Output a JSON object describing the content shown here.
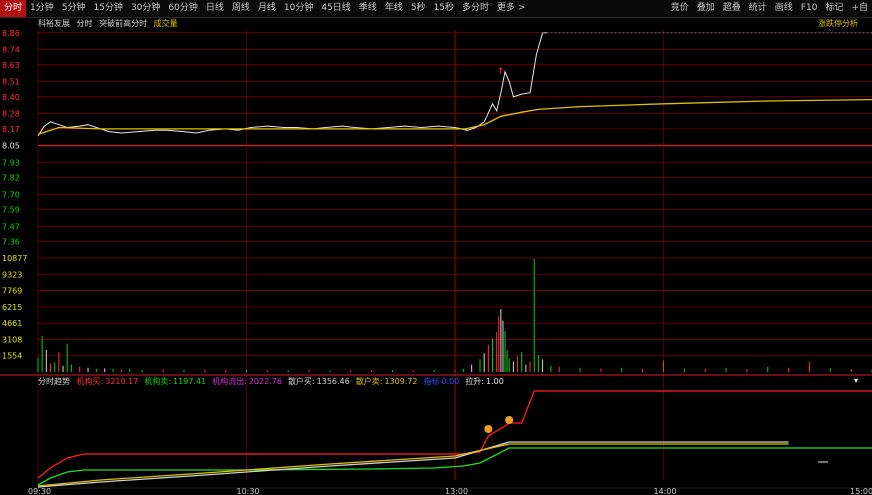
{
  "toolbar": {
    "periods": [
      "分时",
      "1分钟",
      "5分钟",
      "15分钟",
      "30分钟",
      "60分钟",
      "日线",
      "周线",
      "月线",
      "10分钟",
      "45日线",
      "季线",
      "年线",
      "5秒",
      "15秒",
      "多分时",
      "更多 >"
    ],
    "active_period": "分时",
    "tools": [
      "竞价",
      "叠加",
      "超叠",
      "统计",
      "画线",
      "F10",
      "标记",
      "+自"
    ]
  },
  "stock": {
    "name": "科裕友展",
    "chart_mode": "分时",
    "overlay": "突破前高分时",
    "volume_label": "成交量",
    "analysis_link": "涨跌停分析"
  },
  "colors": {
    "up": "#ff3232",
    "down": "#00d000",
    "price_line": "#e8e8e8",
    "avg_line": "#e0c000",
    "grid": "#7a0000",
    "accent": "#e0c000"
  },
  "price_axis": {
    "labels": [
      "8.86",
      "8.74",
      "8.63",
      "8.51",
      "8.40",
      "8.28",
      "8.17",
      "8.05",
      "7.93",
      "7.82",
      "7.70",
      "7.59",
      "7.47",
      "7.36"
    ],
    "prev_close": "8.05"
  },
  "volume_axis": {
    "labels": [
      "10877",
      "9323",
      "7769",
      "6215",
      "4661",
      "3108",
      "1554"
    ]
  },
  "time_axis": {
    "labels": [
      "09:30",
      "10:30",
      "13:00",
      "14:00",
      "15:00"
    ]
  },
  "indicator": {
    "name": "分时趋势",
    "items": [
      {
        "label": "机构买:",
        "value": "3210.17",
        "color": "#ff3030"
      },
      {
        "label": "机构卖:",
        "value": "1197.41",
        "color": "#00d000"
      },
      {
        "label": "机构流出:",
        "value": "2022.76",
        "color": "#d030d0"
      },
      {
        "label": "散户买:",
        "value": "1356.46",
        "color": "#d0d0d0"
      },
      {
        "label": "散户卖:",
        "value": "1309.72",
        "color": "#e0c000"
      },
      {
        "label": "指标",
        "value": "0.00",
        "color": "#3050ff"
      },
      {
        "label": "拉升:",
        "value": "1.00",
        "color": "#e8e8e8"
      }
    ]
  },
  "chart_data": {
    "type": "line",
    "x_axis": "time",
    "x_ticks": [
      "09:30",
      "10:30",
      "13:00",
      "14:00",
      "15:00"
    ],
    "price": {
      "ylim": [
        7.3,
        8.88
      ],
      "prev_close": 8.05,
      "series": [
        {
          "values": [
            [
              0,
              8.12
            ],
            [
              3,
              8.19
            ],
            [
              6,
              8.22
            ],
            [
              10,
              8.2
            ],
            [
              14,
              8.18
            ],
            [
              20,
              8.19
            ],
            [
              24,
              8.2
            ],
            [
              28,
              8.18
            ],
            [
              34,
              8.15
            ],
            [
              40,
              8.14
            ],
            [
              48,
              8.15
            ],
            [
              56,
              8.16
            ],
            [
              62,
              8.16
            ],
            [
              70,
              8.15
            ],
            [
              76,
              8.14
            ],
            [
              82,
              8.16
            ],
            [
              90,
              8.17
            ],
            [
              96,
              8.16
            ],
            [
              102,
              8.18
            ],
            [
              110,
              8.19
            ],
            [
              118,
              8.18
            ],
            [
              124,
              8.18
            ],
            [
              132,
              8.17
            ],
            [
              138,
              8.18
            ],
            [
              146,
              8.19
            ],
            [
              152,
              8.18
            ],
            [
              160,
              8.17
            ],
            [
              168,
              8.18
            ],
            [
              176,
              8.19
            ],
            [
              184,
              8.18
            ],
            [
              192,
              8.19
            ],
            [
              200,
              8.18
            ],
            [
              206,
              8.16
            ],
            [
              210,
              8.18
            ],
            [
              214,
              8.22
            ],
            [
              218,
              8.35
            ],
            [
              220,
              8.3
            ],
            [
              222,
              8.43
            ],
            [
              224,
              8.58
            ],
            [
              226,
              8.51
            ],
            [
              228,
              8.4
            ],
            [
              232,
              8.42
            ],
            [
              236,
              8.43
            ],
            [
              239,
              8.7
            ],
            [
              242,
              8.86
            ],
            [
              244,
              8.86
            ]
          ]
        },
        {
          "values": [
            [
              0,
              8.13
            ],
            [
              10,
              8.18
            ],
            [
              30,
              8.17
            ],
            [
              60,
              8.17
            ],
            [
              100,
              8.17
            ],
            [
              140,
              8.17
            ],
            [
              180,
              8.17
            ],
            [
              205,
              8.17
            ],
            [
              214,
              8.2
            ],
            [
              222,
              8.26
            ],
            [
              232,
              8.29
            ],
            [
              240,
              8.31
            ],
            [
              260,
              8.33
            ],
            [
              300,
              8.35
            ],
            [
              350,
              8.37
            ],
            [
              400,
              8.38
            ]
          ]
        }
      ]
    },
    "volume": {
      "ylim": [
        0,
        10877
      ],
      "values": [
        [
          0,
          1400
        ],
        [
          2,
          3400
        ],
        [
          4,
          2100
        ],
        [
          6,
          800
        ],
        [
          8,
          900
        ],
        [
          10,
          1900
        ],
        [
          12,
          600
        ],
        [
          14,
          2700
        ],
        [
          16,
          700
        ],
        [
          20,
          500
        ],
        [
          24,
          400
        ],
        [
          28,
          300
        ],
        [
          32,
          350
        ],
        [
          36,
          300
        ],
        [
          40,
          250
        ],
        [
          44,
          300
        ],
        [
          50,
          200
        ],
        [
          60,
          250
        ],
        [
          70,
          200
        ],
        [
          80,
          220
        ],
        [
          90,
          180
        ],
        [
          100,
          200
        ],
        [
          110,
          160
        ],
        [
          120,
          180
        ],
        [
          130,
          200
        ],
        [
          140,
          150
        ],
        [
          150,
          180
        ],
        [
          160,
          170
        ],
        [
          170,
          200
        ],
        [
          180,
          160
        ],
        [
          190,
          200
        ],
        [
          200,
          220
        ],
        [
          204,
          300
        ],
        [
          208,
          700
        ],
        [
          212,
          1200
        ],
        [
          214,
          1800
        ],
        [
          216,
          2600
        ],
        [
          218,
          3200
        ],
        [
          220,
          3800
        ],
        [
          221,
          5300
        ],
        [
          222,
          6000
        ],
        [
          223,
          4900
        ],
        [
          224,
          3900
        ],
        [
          225,
          2100
        ],
        [
          226,
          1300
        ],
        [
          228,
          1000
        ],
        [
          230,
          1500
        ],
        [
          232,
          1900
        ],
        [
          234,
          700
        ],
        [
          236,
          1000
        ],
        [
          238,
          10800
        ],
        [
          240,
          1600
        ],
        [
          242,
          1200
        ],
        [
          246,
          600
        ],
        [
          250,
          500
        ],
        [
          260,
          400
        ],
        [
          270,
          350
        ],
        [
          280,
          400
        ],
        [
          290,
          300
        ],
        [
          300,
          1100
        ],
        [
          310,
          350
        ],
        [
          320,
          300
        ],
        [
          330,
          400
        ],
        [
          340,
          300
        ],
        [
          350,
          500
        ],
        [
          360,
          400
        ],
        [
          370,
          1000
        ],
        [
          380,
          350
        ],
        [
          390,
          300
        ],
        [
          400,
          200
        ]
      ]
    },
    "trend": {
      "series": [
        {
          "name": "机构买",
          "values": [
            [
              0,
              1
            ],
            [
              6,
              2
            ],
            [
              14,
              3
            ],
            [
              22,
              3.4
            ],
            [
              100,
              3.4
            ],
            [
              204,
              3.4
            ],
            [
              212,
              3.6
            ],
            [
              216,
              5.2
            ],
            [
              224,
              6.2
            ],
            [
              226,
              6.5
            ],
            [
              232,
              6.5
            ],
            [
              238,
              9.7
            ],
            [
              400,
              9.7
            ]
          ]
        },
        {
          "name": "机构卖",
          "values": [
            [
              0,
              0.3
            ],
            [
              6,
              1
            ],
            [
              14,
              1.6
            ],
            [
              22,
              1.8
            ],
            [
              100,
              1.8
            ],
            [
              160,
              1.9
            ],
            [
              190,
              2.0
            ],
            [
              204,
              2.2
            ],
            [
              212,
              2.5
            ],
            [
              226,
              4.0
            ],
            [
              400,
              4.0
            ]
          ]
        },
        {
          "name": "散户买",
          "values": [
            [
              0,
              0.1
            ],
            [
              30,
              0.6
            ],
            [
              80,
              1.3
            ],
            [
              140,
              2.2
            ],
            [
              200,
              3.0
            ],
            [
              226,
              4.6
            ],
            [
              360,
              4.6
            ]
          ]
        },
        {
          "name": "散户卖",
          "values": [
            [
              0,
              0.2
            ],
            [
              30,
              0.8
            ],
            [
              80,
              1.5
            ],
            [
              140,
              2.4
            ],
            [
              200,
              3.2
            ],
            [
              226,
              4.4
            ],
            [
              360,
              4.4
            ]
          ]
        }
      ]
    }
  }
}
